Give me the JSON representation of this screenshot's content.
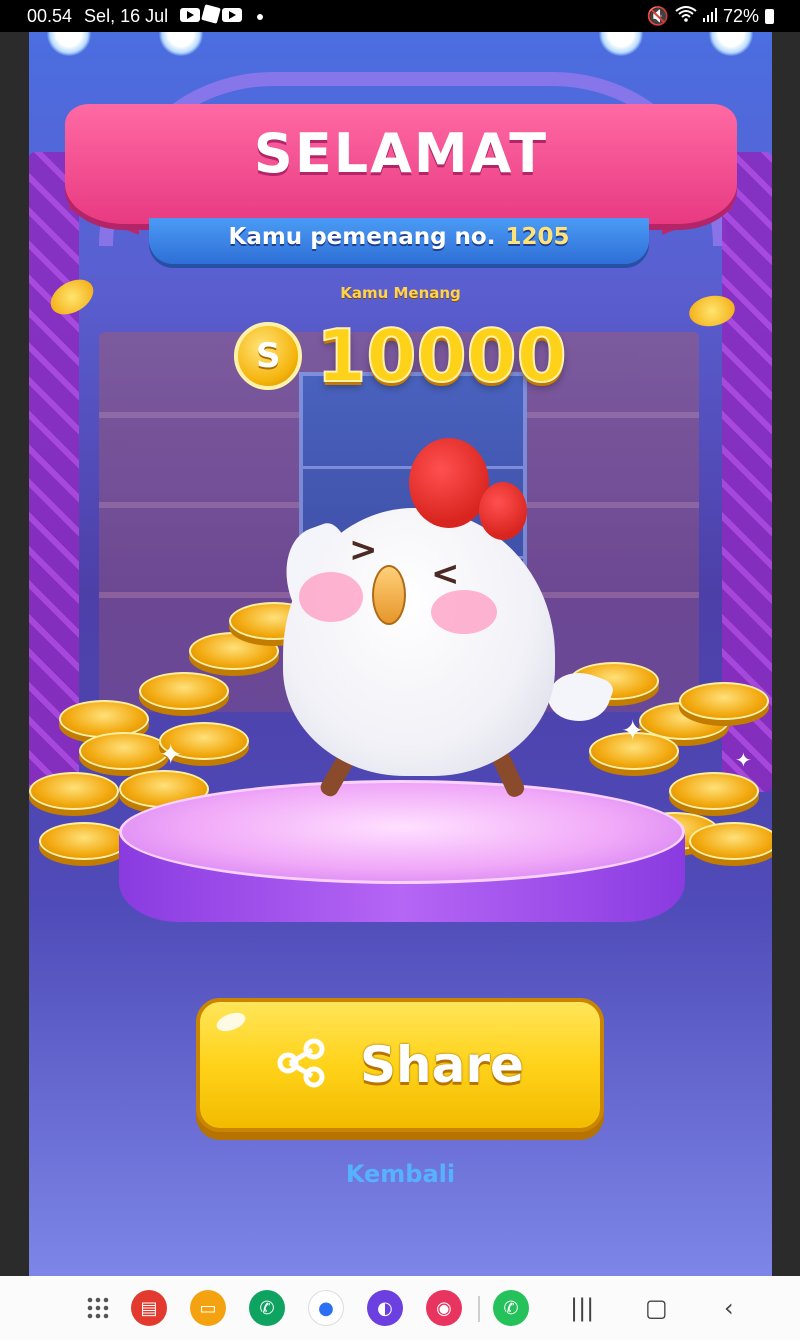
{
  "status_bar": {
    "time": "00.54",
    "date": "Sel, 16 Jul",
    "battery": "72%"
  },
  "banner": {
    "title": "SELAMAT",
    "winner_label": "Kamu pemenang no.",
    "winner_number": "1205"
  },
  "prize": {
    "label": "Kamu Menang",
    "coin_symbol": "S",
    "amount": "10000"
  },
  "actions": {
    "share_label": "Share",
    "back_label": "Kembali"
  },
  "nav_bar": {
    "apps": [
      "apps-grid-icon",
      "notes-app-icon",
      "files-app-icon",
      "phone-app-icon",
      "messages-app-icon",
      "internet-app-icon",
      "screen-recorder-icon",
      "whatsapp-icon"
    ],
    "system_buttons": [
      "recents-button",
      "home-button",
      "back-button"
    ]
  },
  "colors": {
    "banner_pink": "#e83a82",
    "winner_bar_blue": "#2f6fd6",
    "coin_gold": "#ffd21a",
    "share_yellow": "#ffd31a",
    "back_link_blue": "#56b2ff"
  }
}
